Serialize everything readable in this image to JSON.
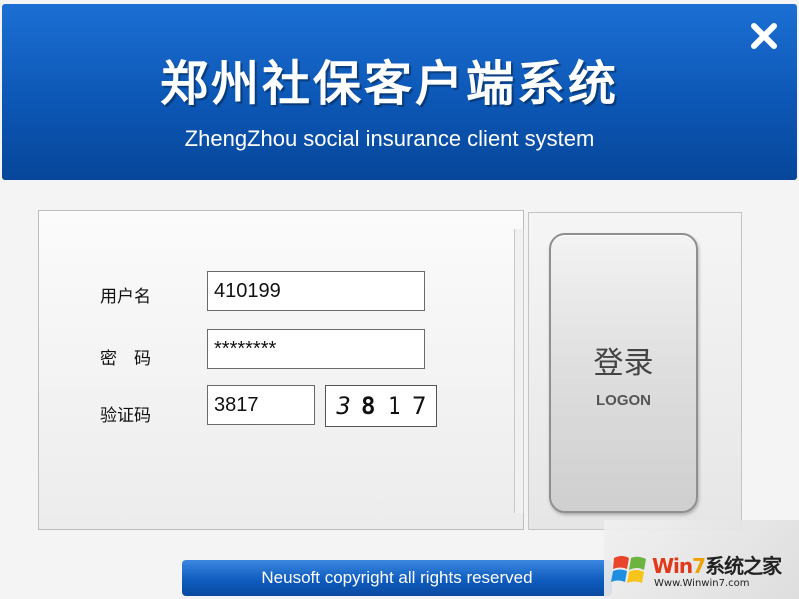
{
  "header": {
    "title_cn": "郑州社保客户端系统",
    "title_en": "ZhengZhou social insurance client system"
  },
  "form": {
    "username_label": "用户名",
    "username_value": "410199",
    "password_label": "密　码",
    "password_value": "********",
    "captcha_label": "验证码",
    "captcha_value": "3817",
    "captcha_chars": [
      "3",
      "8",
      "1",
      "7"
    ]
  },
  "logon": {
    "label_cn": "登录",
    "label_en": "LOGON"
  },
  "footer": {
    "text": "Neusoft copyright all rights reserved"
  },
  "watermark": {
    "brand_win": "Win",
    "brand_seven": "7",
    "brand_cn": "系统之家",
    "url": "Www.Winwin7.com"
  },
  "colors": {
    "header_blue": "#0c57b5",
    "footer_blue": "#0d59bc"
  },
  "icons": {
    "close": "close-icon",
    "watermark_logo": "windows-logo-icon"
  }
}
